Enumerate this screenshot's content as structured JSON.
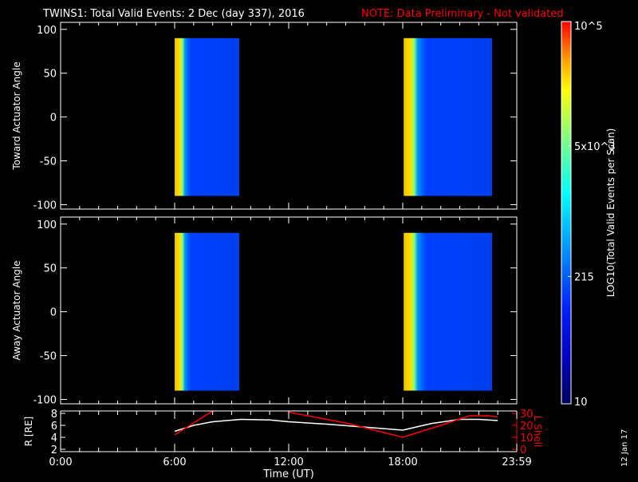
{
  "title": "TWINS1: Total Valid Events:  2 Dec (day 337), 2016",
  "note": "NOTE: Data Preliminary - Not validated",
  "footer_date": "12 Jan 17",
  "colors": {
    "note": "#ff0000",
    "r_line": "#ffffff",
    "lshell_line": "#ff0000"
  },
  "chart_data": [
    {
      "type": "heatmap",
      "ylabel": "Toward Actuator Angle",
      "yticks": [
        "100",
        "50",
        "0",
        "-50",
        "-100"
      ],
      "ytick_values": [
        100,
        50,
        0,
        -50,
        -100
      ],
      "ylim": [
        -105,
        108
      ],
      "xlim_hours": [
        0,
        24
      ],
      "data_intervals_hours": [
        [
          6.0,
          9.4
        ],
        [
          18.05,
          22.7
        ]
      ],
      "angle_range": [
        -90,
        90
      ]
    },
    {
      "type": "heatmap",
      "ylabel": "Away Actuator Angle",
      "yticks": [
        "100",
        "50",
        "0",
        "-50",
        "-100"
      ],
      "ytick_values": [
        100,
        50,
        0,
        -50,
        -100
      ],
      "ylim": [
        -105,
        108
      ],
      "xlim_hours": [
        0,
        24
      ],
      "data_intervals_hours": [
        [
          6.0,
          9.4
        ],
        [
          18.05,
          22.7
        ]
      ],
      "angle_range": [
        -90,
        90
      ]
    },
    {
      "type": "line",
      "ylabel": "R [RE]",
      "ylabel_right": "L Shell",
      "xlabel": "Time (UT)",
      "xticks": [
        "0:00",
        "6:00",
        "12:00",
        "18:00",
        "23:59"
      ],
      "xtick_hours": [
        0,
        6,
        12,
        18,
        24
      ],
      "yticks": [
        "2",
        "4",
        "6",
        "8"
      ],
      "ytick_values": [
        2,
        4,
        6,
        8
      ],
      "ylim": [
        1.6,
        8.4
      ],
      "yticks_right": [
        "0",
        "10",
        "20",
        "30"
      ],
      "ytick_right_values": [
        0,
        10,
        20,
        30
      ],
      "ylim_right": [
        -2,
        32
      ],
      "series": [
        {
          "name": "R",
          "axis": "left",
          "x": [
            6.0,
            7.0,
            8.0,
            9.5,
            11.0,
            12.0,
            14.0,
            16.0,
            18.0,
            19.5,
            21.0,
            22.0,
            23.0
          ],
          "y": [
            5.0,
            6.0,
            6.6,
            7.0,
            6.9,
            6.6,
            6.2,
            5.7,
            5.2,
            6.3,
            7.0,
            7.0,
            6.8
          ]
        },
        {
          "name": "L Shell",
          "axis": "right",
          "x": [
            6.0,
            8.0
          ],
          "y": [
            12,
            32
          ]
        },
        {
          "name": "L Shell",
          "axis": "right",
          "x": [
            12.0,
            15.0,
            18.0,
            20.0,
            21.5,
            22.5,
            23.0
          ],
          "y": [
            31,
            22,
            10,
            20,
            28,
            28,
            27
          ]
        }
      ]
    },
    {
      "type": "colorbar",
      "label": "LOG10(Total Valid Events per Scan)",
      "ticks": [
        "10",
        "215",
        "5x10^3",
        "10^5"
      ],
      "tick_values": [
        10,
        215,
        5000,
        100000
      ],
      "range": [
        10,
        100000
      ]
    }
  ]
}
